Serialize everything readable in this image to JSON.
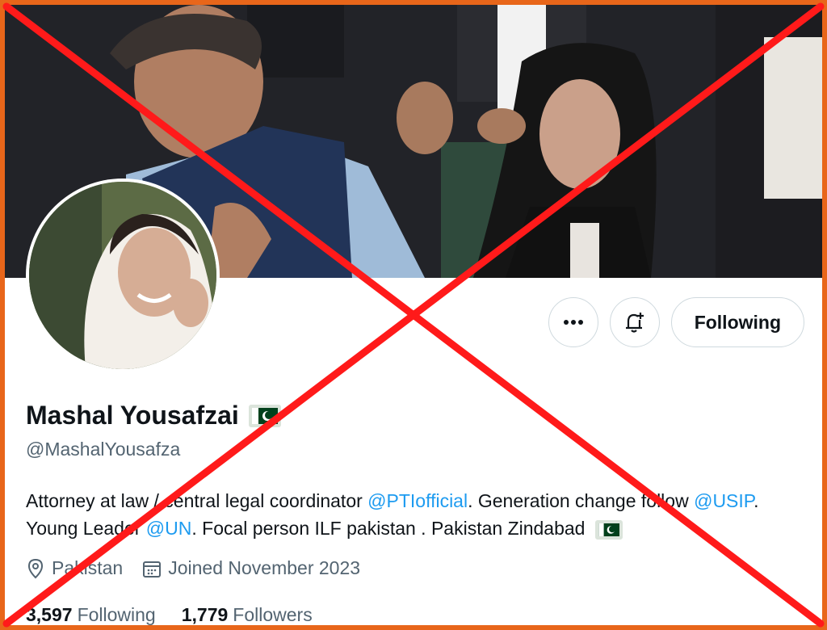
{
  "profile": {
    "name": "Mashal Yousafzai",
    "handle": "@MashalYousafza",
    "bio_parts": {
      "p1": "Attorney at law / central legal coordinator ",
      "m1": "@PTIofficial",
      "p2": ". Generation change follow ",
      "m2": "@USIP",
      "p3": ". Young Leader ",
      "m3": "@UN",
      "p4": ". Focal person ILF pakistan . Pakistan Zindabad"
    },
    "location": "Pakistan",
    "joined": "Joined November 2023"
  },
  "stats": {
    "following_count": "3,597",
    "following_label": "Following",
    "followers_count": "1,779",
    "followers_label": "Followers"
  },
  "actions": {
    "more_icon": "more-icon",
    "notify_icon": "bell-plus-icon",
    "follow_label": "Following"
  },
  "colors": {
    "accent": "#1d9bf0",
    "frame": "#e8661a",
    "cross": "#ff1a1a",
    "muted": "#536471"
  }
}
